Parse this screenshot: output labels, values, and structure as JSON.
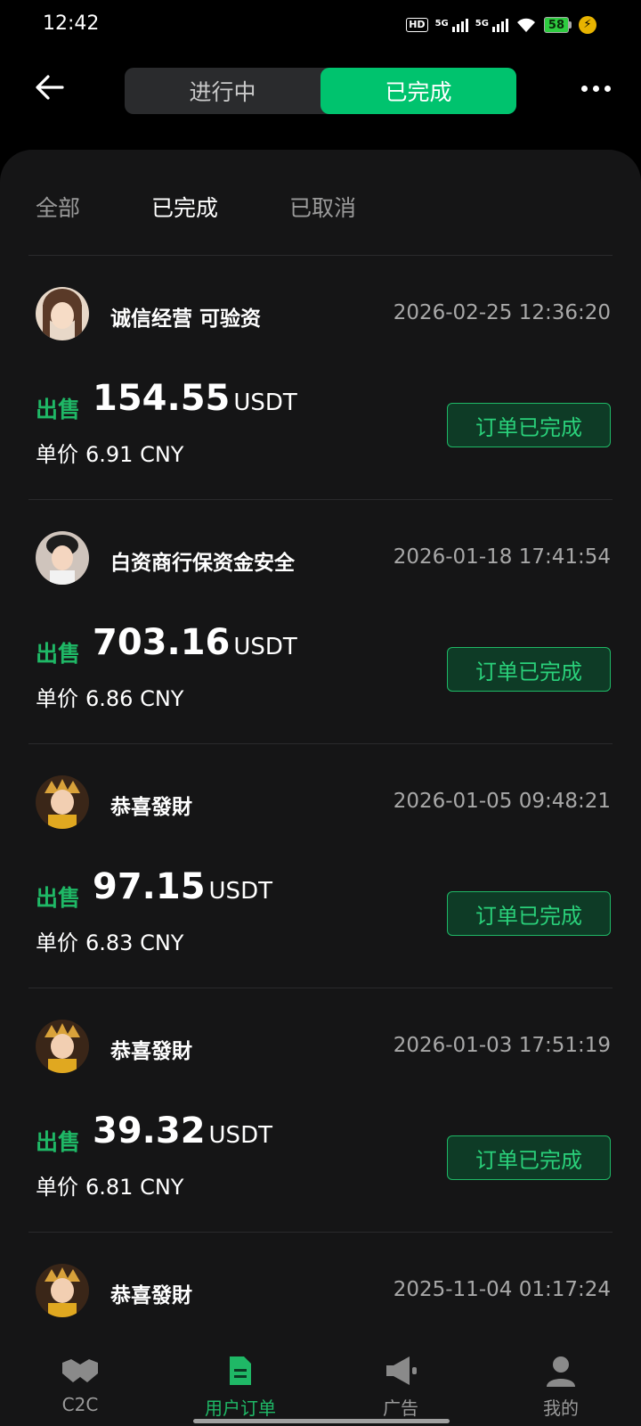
{
  "status_bar": {
    "time": "12:42",
    "hd": "HD",
    "net1": "5G",
    "net2": "5G",
    "battery": "58"
  },
  "header": {
    "segments": [
      "进行中",
      "已完成"
    ],
    "active_segment": 1
  },
  "filters": [
    "全部",
    "已完成",
    "已取消"
  ],
  "orders": [
    {
      "merchant": "诚信经营 可验资",
      "time": "2026-02-25 12:36:20",
      "side": "出售",
      "amount": "154.55",
      "unit": "USDT",
      "price_label": "单价",
      "price": "6.91 CNY",
      "status": "订单已完成"
    },
    {
      "merchant": "白资商行保资金安全",
      "time": "2026-01-18 17:41:54",
      "side": "出售",
      "amount": "703.16",
      "unit": "USDT",
      "price_label": "单价",
      "price": "6.86 CNY",
      "status": "订单已完成"
    },
    {
      "merchant": "恭喜發財",
      "time": "2026-01-05 09:48:21",
      "side": "出售",
      "amount": "97.15",
      "unit": "USDT",
      "price_label": "单价",
      "price": "6.83 CNY",
      "status": "订单已完成"
    },
    {
      "merchant": "恭喜發財",
      "time": "2026-01-03 17:51:19",
      "side": "出售",
      "amount": "39.32",
      "unit": "USDT",
      "price_label": "单价",
      "price": "6.81 CNY",
      "status": "订单已完成"
    },
    {
      "merchant": "恭喜發財",
      "time": "2025-11-04 01:17:24"
    }
  ],
  "tabbar": [
    {
      "label": "C2C",
      "icon": "handshake-icon"
    },
    {
      "label": "用户订单",
      "icon": "document-icon"
    },
    {
      "label": "广告",
      "icon": "megaphone-icon"
    },
    {
      "label": "我的",
      "icon": "person-icon"
    }
  ],
  "colors": {
    "accent": "#00c36e",
    "sell": "#1fb866",
    "background": "#000000",
    "panel": "#151516"
  }
}
